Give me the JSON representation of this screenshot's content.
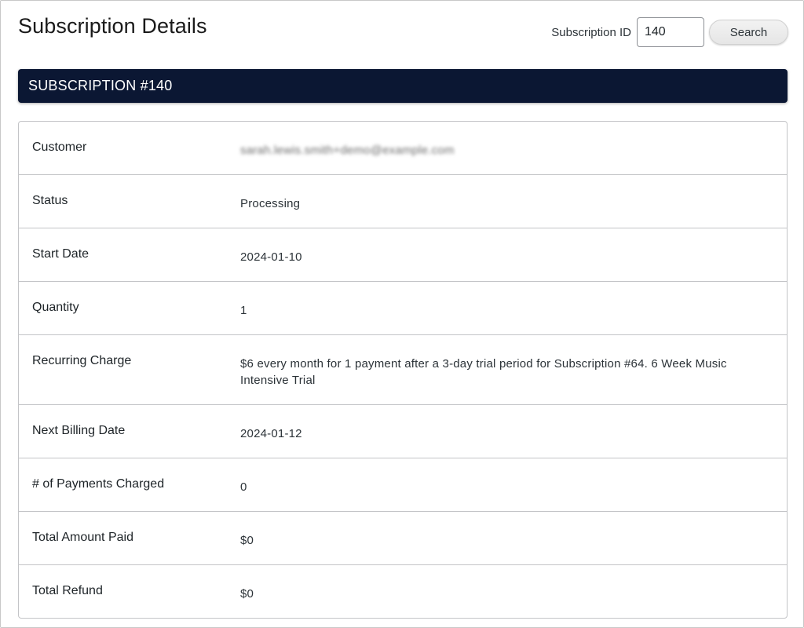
{
  "page": {
    "title": "Subscription Details"
  },
  "search": {
    "label": "Subscription ID",
    "value": "140",
    "button_label": "Search"
  },
  "subscription": {
    "header": "SUBSCRIPTION #140"
  },
  "details": [
    {
      "label": "Customer",
      "value": "sarah.lewis.smith+demo@example.com"
    },
    {
      "label": "Status",
      "value": "Processing"
    },
    {
      "label": "Start Date",
      "value": "2024-01-10"
    },
    {
      "label": "Quantity",
      "value": "1"
    },
    {
      "label": "Recurring Charge",
      "value": "$6 every month for 1 payment after a 3-day trial period for Subscription #64. 6 Week Music Intensive Trial"
    },
    {
      "label": "Next Billing Date",
      "value": "2024-01-12"
    },
    {
      "label": "# of Payments Charged",
      "value": "0"
    },
    {
      "label": "Total Amount Paid",
      "value": "$0"
    },
    {
      "label": "Total Refund",
      "value": "$0"
    }
  ]
}
